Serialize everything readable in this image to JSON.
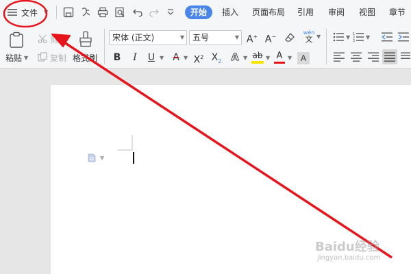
{
  "menu": {
    "file_label": "文件",
    "tabs": [
      "开始",
      "插入",
      "页面布局",
      "引用",
      "审阅",
      "视图",
      "章节"
    ]
  },
  "ribbon": {
    "paste_label": "粘贴",
    "cut_label": "剪切",
    "copy_label": "复制",
    "format_painter_label": "格式刷",
    "font_name": "宋体 (正文)",
    "font_size": "五号",
    "phonetic_label": "wén"
  },
  "colors": {
    "accent": "#4a86e8",
    "annotation": "#e8141c",
    "highlight_bar": "#f5e600",
    "font_color_bar": "#e8141c"
  },
  "watermark": {
    "brand": "Baidu经验",
    "url": "jingyan.baidu.com"
  }
}
